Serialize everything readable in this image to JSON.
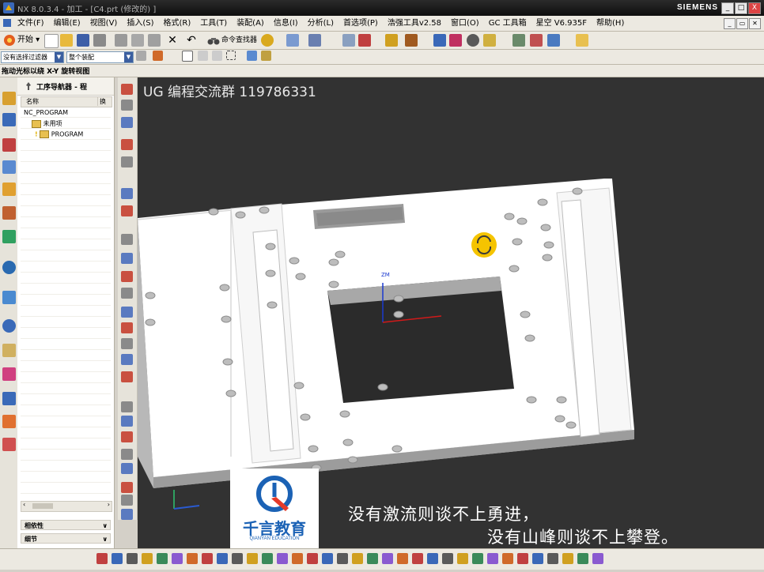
{
  "window": {
    "title": "NX 8.0.3.4 - 加工 - [C4.prt  (修改的) ]",
    "brand": "SIEMENS",
    "buttons": {
      "minimize": "_",
      "restore": "□",
      "close": "X"
    }
  },
  "menubar": {
    "items": [
      "文件(F)",
      "编辑(E)",
      "视图(V)",
      "插入(S)",
      "格式(R)",
      "工具(T)",
      "装配(A)",
      "信息(I)",
      "分析(L)",
      "首选项(P)",
      "浩强工具v2.58",
      "窗口(O)",
      "GC 工具箱",
      "星空 V6.935F",
      "帮助(H)"
    ]
  },
  "toolbar": {
    "start_label": "开始",
    "command_finder_label": "命令查找器"
  },
  "selection_bar": {
    "filter_value": "没有选择过滤器",
    "scope_value": "整个装配"
  },
  "status": {
    "hint": "拖动光标以绕 X-Y 旋转视图"
  },
  "navigator": {
    "title": "工序导航器 - 程",
    "columns": [
      "名称",
      "换"
    ],
    "rows": [
      {
        "label": "NC_PROGRAM",
        "level": 0
      },
      {
        "label": "未用项",
        "level": 1
      },
      {
        "label": "PROGRAM",
        "level": 1
      }
    ],
    "sections": [
      "相依性",
      "细节"
    ]
  },
  "graphics": {
    "watermark": "UG 编程交流群 119786331",
    "subtitle_line1": "没有激流则谈不上勇进，",
    "subtitle_line2": "没有山峰则谈不上攀登。",
    "logo_name": "千言教育",
    "logo_sub": "QIANYAN EDUCATION",
    "axis_label": "ZM",
    "background": "#323232"
  },
  "colors": {
    "accent": "#3b5fa0",
    "rotate_cursor": "#f5c400"
  }
}
